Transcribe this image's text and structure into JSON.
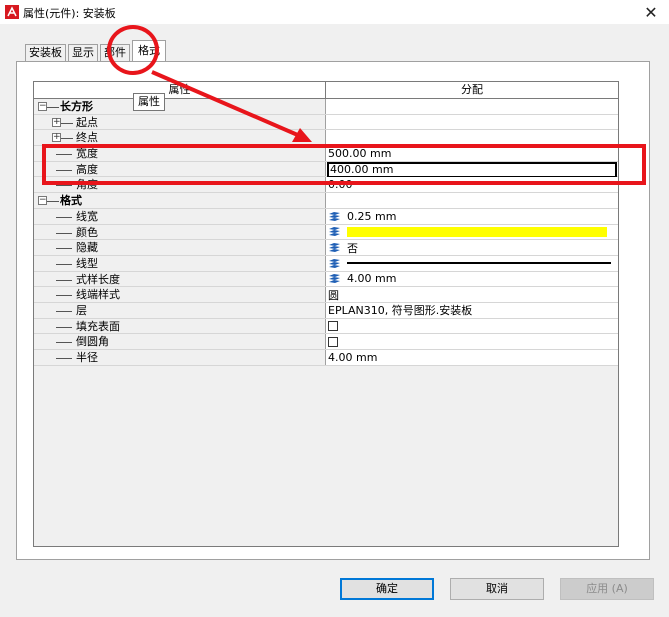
{
  "window": {
    "title": "属性(元件): 安装板",
    "close_glyph": "✕",
    "icon": "app-logo-icon"
  },
  "tabs": [
    {
      "label": "安装板",
      "active": false
    },
    {
      "label": "显示",
      "active": false
    },
    {
      "label": "部件",
      "active": false
    },
    {
      "label": "格式",
      "active": true
    }
  ],
  "tooltip": "属性",
  "grid": {
    "headers": [
      "属性",
      "分配"
    ],
    "rows": [
      {
        "label": "长方形",
        "value": ""
      },
      {
        "label": "起点",
        "value": ""
      },
      {
        "label": "终点",
        "value": ""
      },
      {
        "label": "宽度",
        "value": "500.00 mm"
      },
      {
        "label": "高度",
        "value": "400.00 mm"
      },
      {
        "label": "角度",
        "value": "0.00"
      },
      {
        "label": "格式",
        "value": ""
      },
      {
        "label": "线宽",
        "value": "0.25 mm"
      },
      {
        "label": "颜色",
        "value": ""
      },
      {
        "label": "隐藏",
        "value": "否"
      },
      {
        "label": "线型",
        "value": ""
      },
      {
        "label": "式样长度",
        "value": "4.00 mm"
      },
      {
        "label": "线端样式",
        "value": "圆"
      },
      {
        "label": "层",
        "value": "EPLAN310, 符号图形.安装板"
      },
      {
        "label": "填充表面",
        "value": ""
      },
      {
        "label": "倒圆角",
        "value": ""
      },
      {
        "label": "半径",
        "value": "4.00 mm"
      }
    ]
  },
  "colors": {
    "annotation_red": "#e8151b",
    "swatch_yellow": "#ffff00",
    "layer_icon_blue": "#1f5fb5"
  },
  "buttons": {
    "ok": "确定",
    "cancel": "取消",
    "apply": "应用 (A)"
  }
}
